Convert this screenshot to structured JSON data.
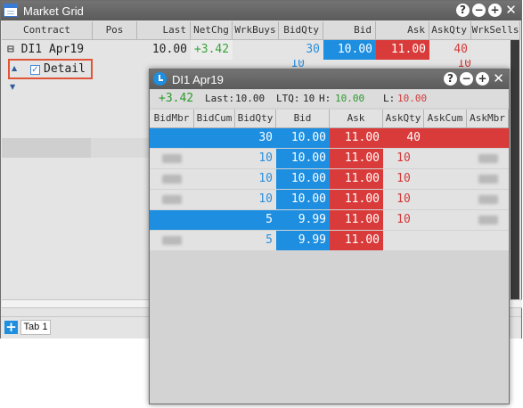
{
  "market_grid": {
    "title": "Market Grid",
    "window_buttons": [
      "?",
      "−",
      "+",
      "✕"
    ],
    "columns": [
      "Contract",
      "Pos",
      "Last",
      "NetChg",
      "WrkBuys",
      "BidQty",
      "Bid",
      "Ask",
      "AskQty",
      "WrkSells"
    ],
    "row": {
      "expand_glyph": "⊟",
      "contract": "DI1 Apr19",
      "last": "10.00",
      "net_chg": "+3.42",
      "bid_qty": "30",
      "bid": "10.00",
      "ask": "11.00",
      "ask_qty": "40",
      "second_bid_qty": "10",
      "second_ask_qty": "10"
    },
    "detail": {
      "label": "Detail",
      "checked": true,
      "check_glyph": "✓",
      "up_arrow": "▲",
      "down_arrow": "▼"
    },
    "tab_bar": {
      "add_label": "+",
      "tab_label": "Tab 1"
    }
  },
  "dom": {
    "title": "DI1 Apr19",
    "window_buttons": [
      "?",
      "−",
      "+",
      "✕"
    ],
    "net_chg": "+3.42",
    "last_label": "Last:",
    "last_value": "10.00",
    "ltq_label": "LTQ:",
    "ltq_value": "10",
    "high_label": "H:",
    "high_value": "10.00",
    "low_label": "L:",
    "low_value": "10.00",
    "columns": [
      "BidMbr",
      "BidCum",
      "BidQty",
      "Bid",
      "Ask",
      "AskQty",
      "AskCum",
      "AskMbr"
    ],
    "rows": [
      {
        "bid_qty": "30",
        "bid": "10.00",
        "ask": "11.00",
        "ask_qty": "40"
      },
      {
        "bid_qty": "10",
        "bid": "10.00",
        "ask": "11.00",
        "ask_qty": "10"
      },
      {
        "bid_qty": "10",
        "bid": "10.00",
        "ask": "11.00",
        "ask_qty": "10"
      },
      {
        "bid_qty": "10",
        "bid": "10.00",
        "ask": "11.00",
        "ask_qty": "10"
      },
      {
        "bid_qty": "5",
        "bid": "9.99",
        "ask": "11.00",
        "ask_qty": "10"
      },
      {
        "bid_qty": "5",
        "bid": "9.99",
        "ask": "11.00",
        "ask_qty": ""
      }
    ]
  },
  "colors": {
    "bid_blue": "#1d8ee0",
    "ask_red": "#d93a3a",
    "positive_green": "#3aa33a",
    "qty_blue": "#2b8fdc",
    "qty_red": "#d23b3b"
  }
}
